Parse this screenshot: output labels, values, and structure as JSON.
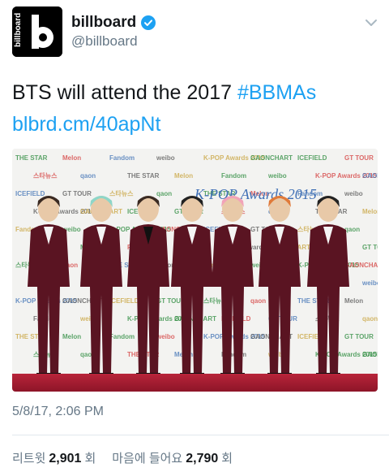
{
  "account": {
    "display_name": "billboard",
    "handle": "@billboard",
    "logo_text": "billboard",
    "logo_letter": "b"
  },
  "tweet": {
    "text_plain": "BTS will attend the 2017 ",
    "hashtag": "#BBMAs",
    "link": "blbrd.cm/40apNt"
  },
  "photo": {
    "banner_words": [
      "THE STAR",
      "Melon",
      "Fandom",
      "weibo",
      "K-POP Awards 2015",
      "GAONCHART",
      "ICEFIELD",
      "GT TOUR",
      "스타뉴스",
      "qaon"
    ]
  },
  "meta": {
    "timestamp": "5/8/17, 2:06 PM",
    "retweets_label": "리트윗",
    "retweets_count": "2,901",
    "retweets_unit": "회",
    "likes_label": "마음에 들어요",
    "likes_count": "2,790",
    "likes_unit": "회"
  },
  "colors": {
    "link": "#1da1f2",
    "muted": "#657786",
    "suit": "#5a1422"
  }
}
